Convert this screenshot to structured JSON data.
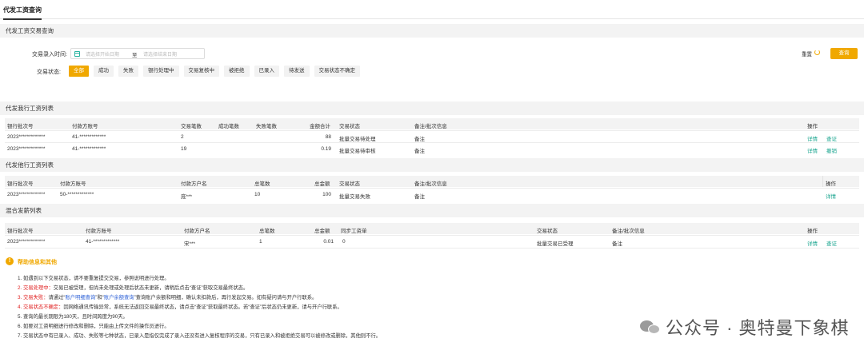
{
  "tab": {
    "title": "代发工资查询"
  },
  "search_section": {
    "title": "代发工资交易查询",
    "date_label": "交易录入时间:",
    "start_placeholder": "请选择开始日期",
    "separator": "至",
    "end_placeholder": "请选择结束日期",
    "status_label": "交易状态:",
    "statuses": [
      "全部",
      "成功",
      "失败",
      "银行处理中",
      "交易复核中",
      "被拒绝",
      "已录入",
      "待发送",
      "交易状态不确定"
    ],
    "active_status": "全部",
    "reset_label": "重置",
    "query_label": "查询"
  },
  "table1": {
    "title": "代发我行工资列表",
    "headers": [
      "银行批次号",
      "付款方账号",
      "交易笔数",
      "成功笔数",
      "失败笔数",
      "金额合计",
      "交易状态",
      "备注/批次信息",
      "操作"
    ],
    "rows": [
      {
        "batch": "2023*************",
        "account": "41-*************",
        "count": "2",
        "success": "",
        "fail": "",
        "amount": "88",
        "status": "批量交易待处理",
        "remark": "备注",
        "op1": "详情",
        "op2": "查证"
      },
      {
        "batch": "2023*************",
        "account": "41-*************",
        "count": "19",
        "success": "",
        "fail": "",
        "amount": "0.19",
        "status": "批量交易待审核",
        "remark": "备注",
        "op1": "详情",
        "op2": "撤销"
      }
    ]
  },
  "table2": {
    "title": "代发他行工资列表",
    "headers": [
      "银行批次号",
      "付款方账号",
      "付款方户名",
      "总笔数",
      "总金额",
      "交易状态",
      "备注/批次信息",
      "操作"
    ],
    "rows": [
      {
        "batch": "2023*************",
        "account": "50-*************",
        "name": "庞***",
        "count": "10",
        "amount": "100",
        "status": "批量交易失败",
        "remark": "备注",
        "op1": "详情"
      }
    ]
  },
  "table3": {
    "title": "混合发薪列表",
    "headers": [
      "银行批次号",
      "付款方账号",
      "付款方户名",
      "总笔数",
      "总金额",
      "同步工资单",
      "交易状态",
      "备注/批次信息",
      "操作"
    ],
    "rows": [
      {
        "batch": "2023*************",
        "account": "41-*************",
        "name": "宋***",
        "count": "1",
        "amount": "0.01",
        "sync": "0",
        "status": "批量交易已受理",
        "remark": "备注",
        "op1": "详情",
        "op2": "查证"
      }
    ]
  },
  "help": {
    "title": "帮助信息和其他",
    "line1": "1. 如遇到以下交易状态，请不要重复提交交易，参照说明进行处理。",
    "line2_label": "2. 交易处理中：",
    "line2_text": "交易已被受理，但尚未处理或处理后状态未更新，请稍后点击“查证”获取交易最终状态。",
    "line3_label": "3. 交易失败：",
    "line3_a": "请通过“",
    "line3_link1": "账户明细查询",
    "line3_b": "”和“",
    "line3_link2": "账户余额查询",
    "line3_c": "”查询账户余额和明细，确认未扣款后，再行发起交易。如有疑问请与开户行联系。",
    "line4_label": "4. 交易状态不确定：",
    "line4_text": "因网络通讯传输异常，系统无法返回交易最终状态，请点击“查证”获取最终状态。若“查证”后状态仍未更新，请与开户行联系。",
    "line5": "5. 查询的最长期限为180天，且时间跨度为90天。",
    "line6": "6. 如要对工资明细进行修改和删除，只能由上传文件的操作员进行。",
    "line7": "7. 交易状态中有已录入、成功、失败等七种状态，已录入是指仅完成了录入还没有进入复核程序的交易，只有已录入和被拒绝交易可以被修改或删除，其他则不行。"
  },
  "watermark": {
    "text": "公众号 · 奥特曼下象棋"
  }
}
